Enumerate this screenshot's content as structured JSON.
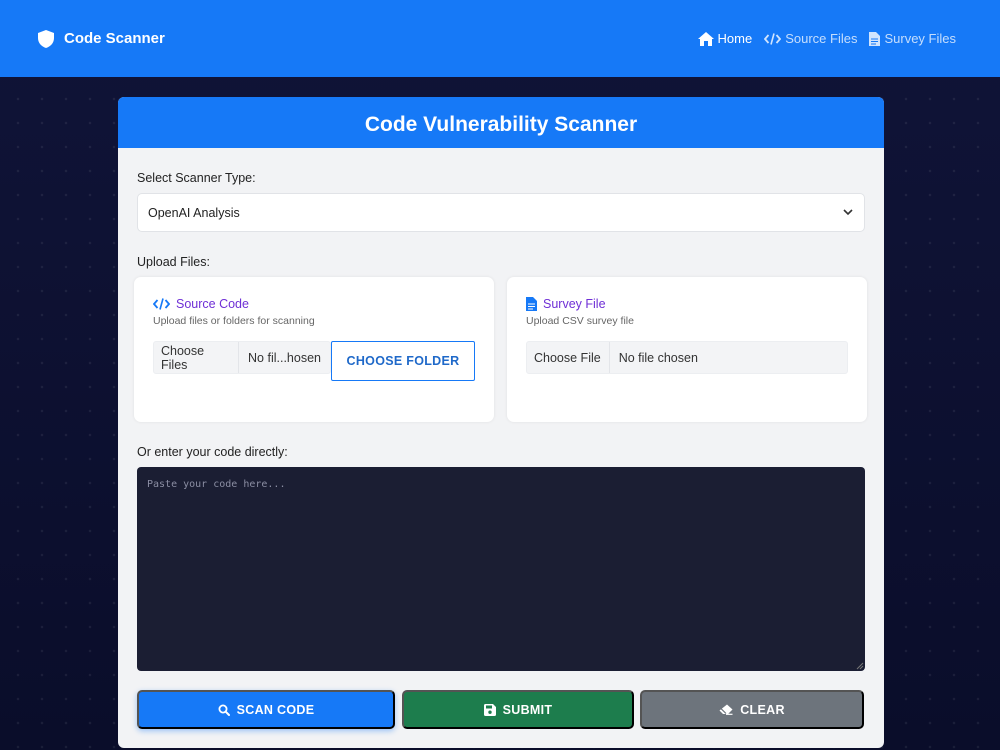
{
  "navbar": {
    "brand": "Code Scanner",
    "links": [
      {
        "label": "Home",
        "icon": "home-icon"
      },
      {
        "label": "Source Files",
        "icon": "code-icon"
      },
      {
        "label": "Survey Files",
        "icon": "file-icon"
      }
    ]
  },
  "card": {
    "title": "Code Vulnerability Scanner",
    "scanner_type_label": "Select Scanner Type:",
    "scanner_type_value": "OpenAI Analysis",
    "upload_label": "Upload Files:",
    "source_panel": {
      "title": "Source Code",
      "subtitle": "Upload files or folders for scanning",
      "choose_files": "Choose Files",
      "file_status": "No fil...hosen",
      "choose_folder": "CHOOSE FOLDER"
    },
    "survey_panel": {
      "title": "Survey File",
      "subtitle": "Upload CSV survey file",
      "choose_file": "Choose File",
      "file_status": "No file chosen"
    },
    "code_label": "Or enter your code directly:",
    "code_placeholder": "Paste your code here...",
    "code_value": "",
    "buttons": {
      "scan": "SCAN CODE",
      "submit": "SUBMIT",
      "clear": "CLEAR"
    }
  },
  "colors": {
    "primary": "#1679f7",
    "success": "#1d7d4d",
    "secondary": "#6d747c",
    "accent_purple": "#6f2fd6",
    "background": "#0b0f2e",
    "editor": "#1b1e33"
  }
}
